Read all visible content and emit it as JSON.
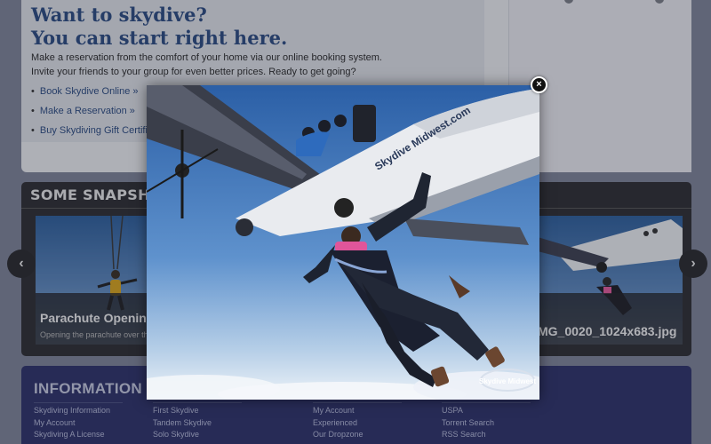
{
  "intro": {
    "headline_line1": "Want to skydive?",
    "headline_line2": "You can start right here.",
    "text_line1": "Make a reservation from the comfort of your home via our online booking system.",
    "text_line2": "Invite your friends to your group for even better prices. Ready to get going?",
    "links": [
      "Book Skydive Online »",
      "Make a Reservation »",
      "Buy Skydiving Gift Certific"
    ]
  },
  "snapshots": {
    "title": "SOME SNAPSHOTS",
    "left_caption_title": "Parachute Openin",
    "left_caption_sub": "Opening the parachute over the",
    "right_caption_title": "MG_0020_1024x683.jpg",
    "prev_icon": "chevron-left-icon",
    "next_icon": "chevron-right-icon"
  },
  "information": {
    "title": "INFORMATION",
    "col1": [
      "Skydiving Information",
      "My Account",
      "Skydiving A License"
    ],
    "col2": [
      "First Skydive",
      "Tandem Skydive",
      "Solo Skydive"
    ],
    "col3": [
      "My Account",
      "Experienced",
      "Our Dropzone"
    ],
    "col4": [
      "USPA",
      "Torrent Search",
      "RSS Search"
    ]
  },
  "lightbox": {
    "close_label": "×",
    "plane_text": "Skydive Midwest.com",
    "watermark": "Skydive Midwest"
  },
  "colors": {
    "headline": "#2d4c80",
    "snap_panel": "#2f2f33",
    "info_panel": "#2e3268",
    "sky_top": "#2f63a8",
    "sky_bottom": "#dfe9f3"
  }
}
